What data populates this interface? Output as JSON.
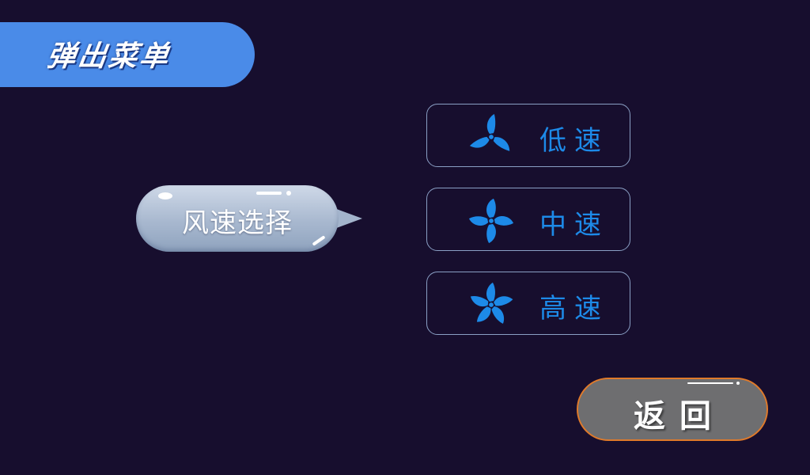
{
  "header": {
    "title": "弹出菜单"
  },
  "bubble": {
    "label": "风速选择"
  },
  "speed_options": [
    {
      "label": "低速",
      "icon": "fan-icon"
    },
    {
      "label": "中速",
      "icon": "fan-icon"
    },
    {
      "label": "高速",
      "icon": "fan-icon"
    }
  ],
  "back": {
    "label": "返回"
  },
  "colors": {
    "background": "#170e2e",
    "title_tab": "#4a8be8",
    "accent_blue": "#1d8ae8",
    "back_button": "#6e6e70",
    "back_border": "#e07a2a"
  }
}
